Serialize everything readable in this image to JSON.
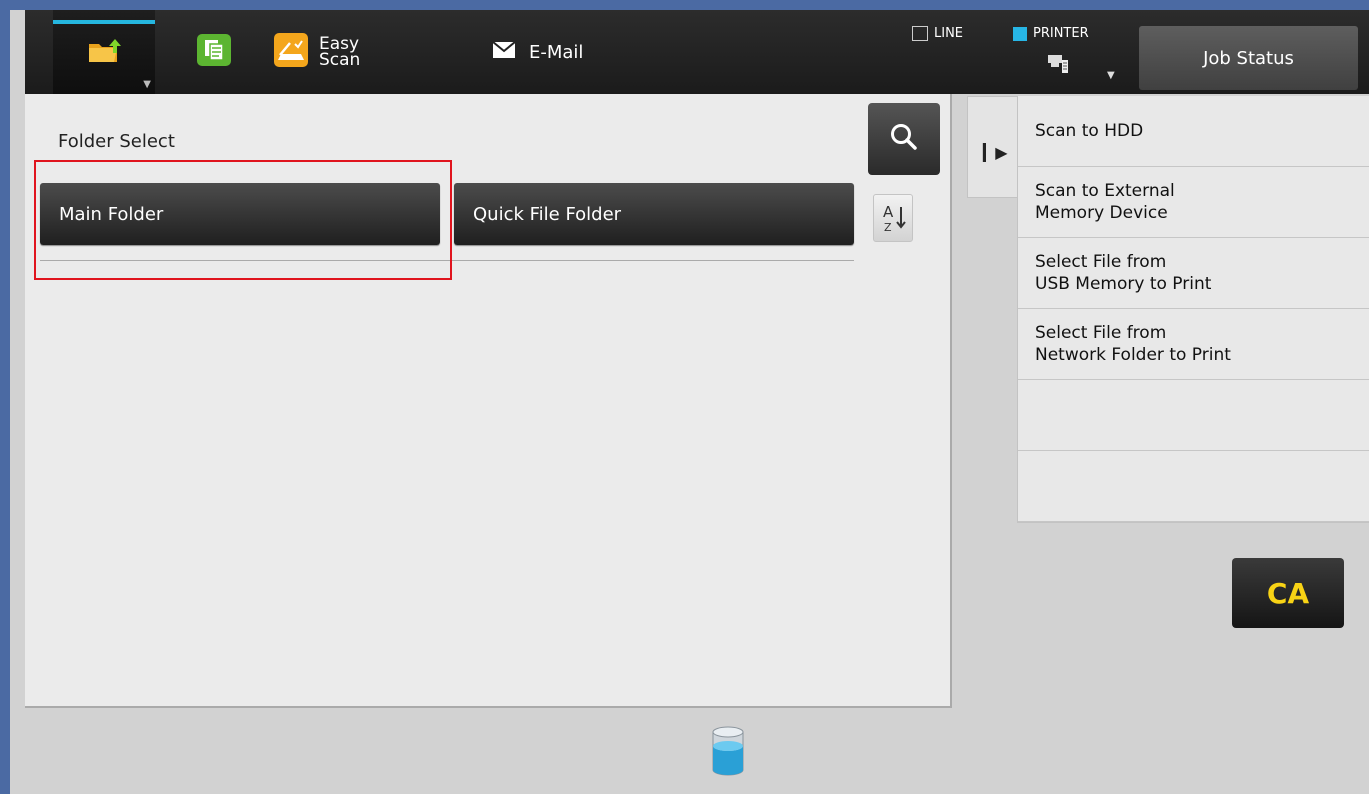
{
  "header": {
    "tabs": [
      {
        "id": "file-retrieve",
        "label": ""
      },
      {
        "id": "copy",
        "label": ""
      },
      {
        "id": "easy-scan",
        "label_line1": "Easy",
        "label_line2": "Scan"
      },
      {
        "id": "email",
        "label": "E-Mail"
      }
    ],
    "status": {
      "line_label": "LINE",
      "printer_label": "PRINTER"
    },
    "job_status_label": "Job Status"
  },
  "main": {
    "title": "Folder Select",
    "folders": [
      {
        "label": "Main Folder"
      },
      {
        "label": "Quick File Folder"
      }
    ]
  },
  "action_menu": {
    "items": [
      {
        "label": "Scan to HDD"
      },
      {
        "label": "Scan to External\nMemory Device"
      },
      {
        "label": "Select File from\nUSB Memory to Print"
      },
      {
        "label": "Select File from\nNetwork Folder to Print"
      },
      {
        "label": ""
      },
      {
        "label": ""
      }
    ]
  },
  "ca_label": "CA",
  "colors": {
    "accent_active_tab": "#25b6df",
    "printer_status": "#27b6e6",
    "highlight": "#e0141e",
    "ca_text": "#f8d315"
  },
  "icons": {
    "file_tab": "folder-upload-icon",
    "copy_tab": "copy-icon",
    "easy_scan_tab": "scanner-icon",
    "email_tab": "envelope-icon",
    "search": "magnifier-icon",
    "sort": "sort-az-icon",
    "expand": "expand-arrow-icon",
    "printer": "printer-device-icon",
    "storage": "storage-cylinder-icon"
  }
}
